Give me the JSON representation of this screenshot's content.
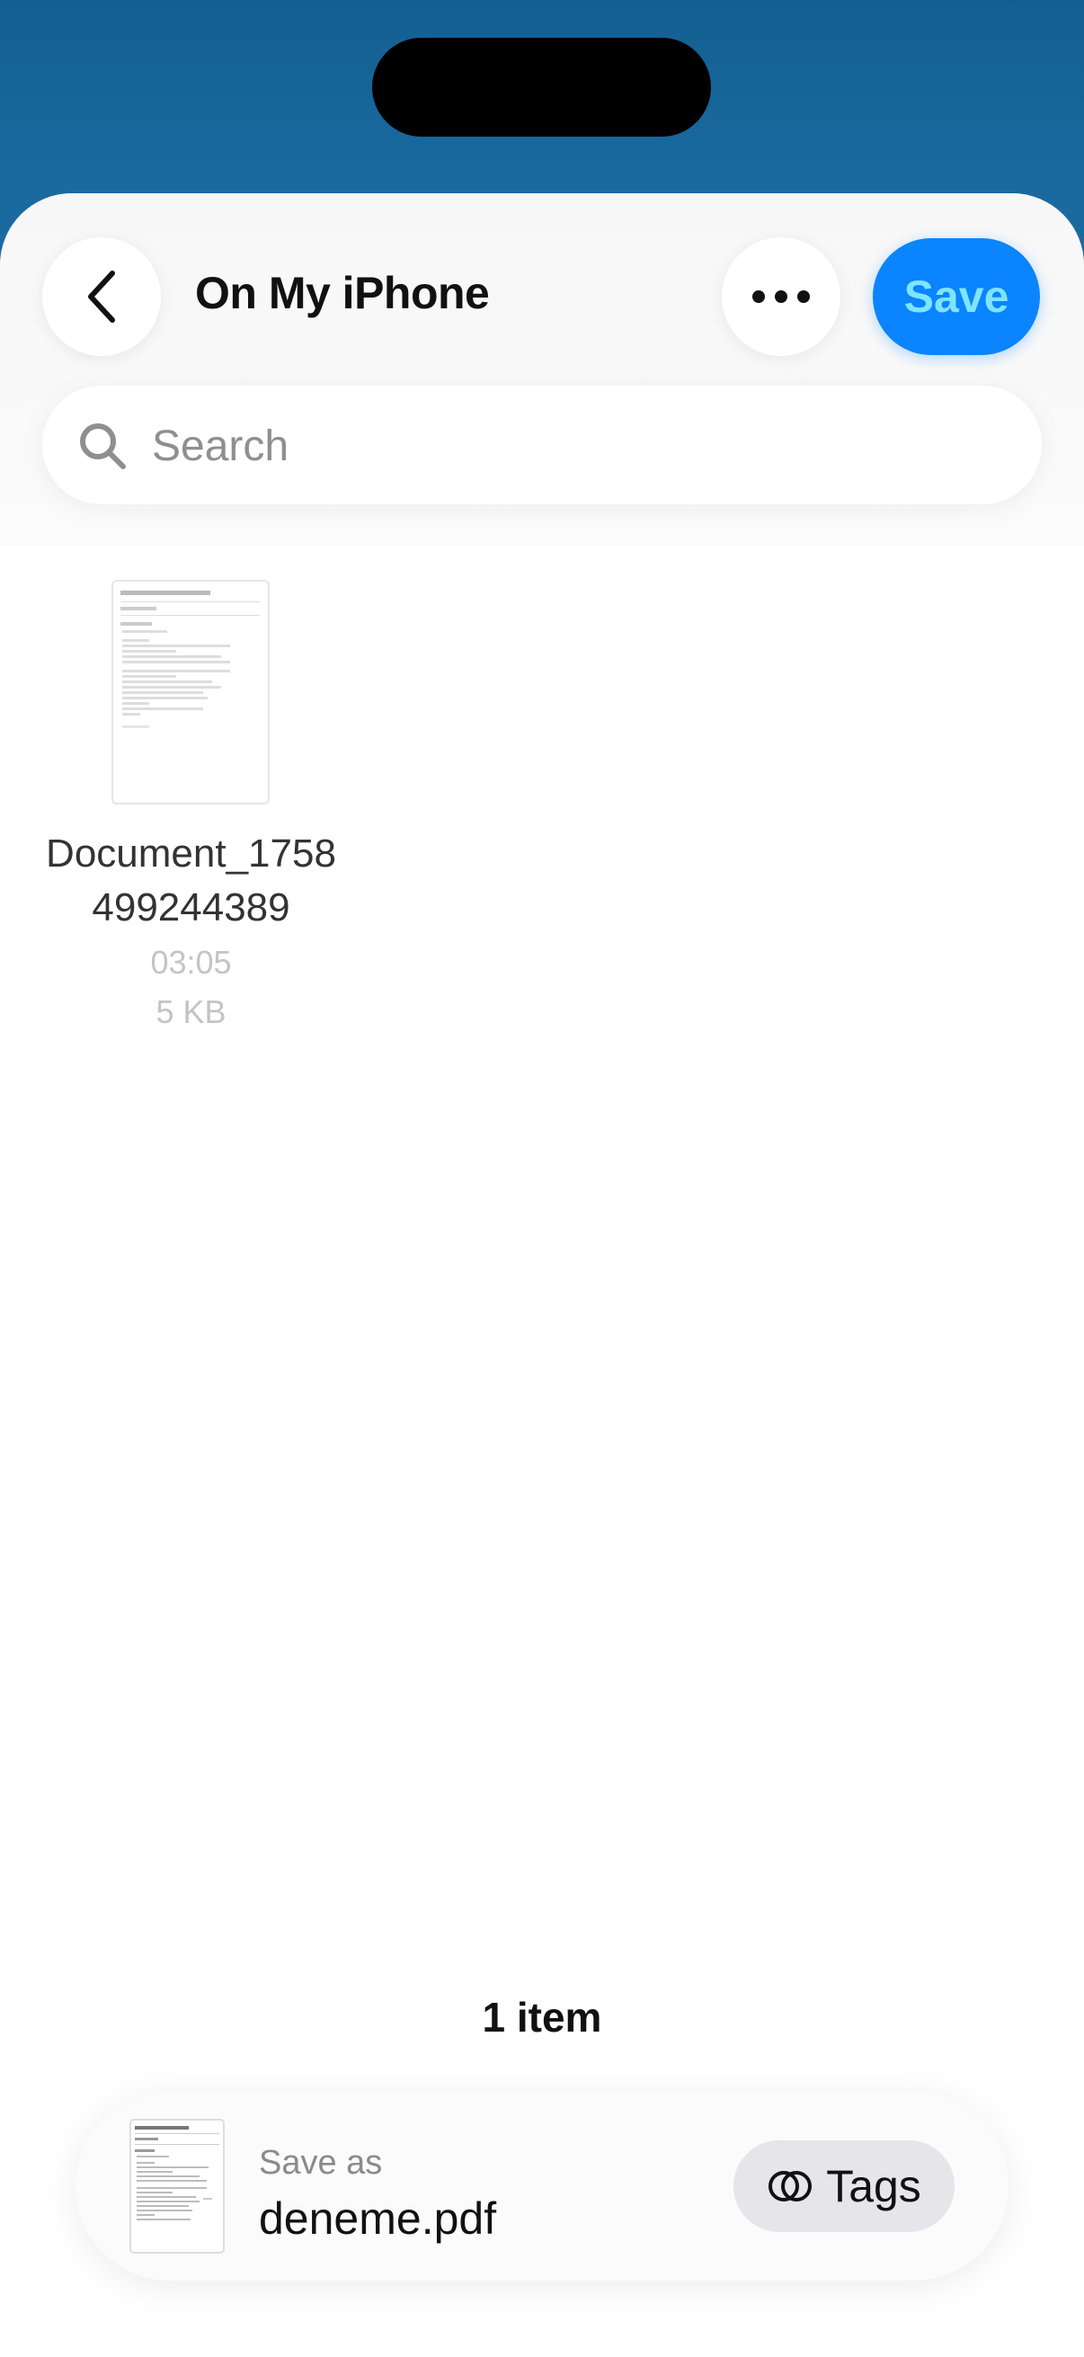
{
  "header": {
    "title": "On My iPhone",
    "save_label": "Save",
    "back_icon": "chevron-left-icon",
    "more_icon": "ellipsis-icon"
  },
  "search": {
    "placeholder": "Search",
    "value": ""
  },
  "files": [
    {
      "name_line1": "Document_1758",
      "name_line2": "499244389",
      "time": "03:05",
      "size": "5 KB"
    }
  ],
  "footer": {
    "item_count": "1 item",
    "save_as_label": "Save as",
    "filename": "deneme.pdf",
    "tags_label": "Tags"
  },
  "colors": {
    "accent": "#0a84ff",
    "save_text": "#7fe4ff",
    "backdrop": "#1a6aa0"
  }
}
